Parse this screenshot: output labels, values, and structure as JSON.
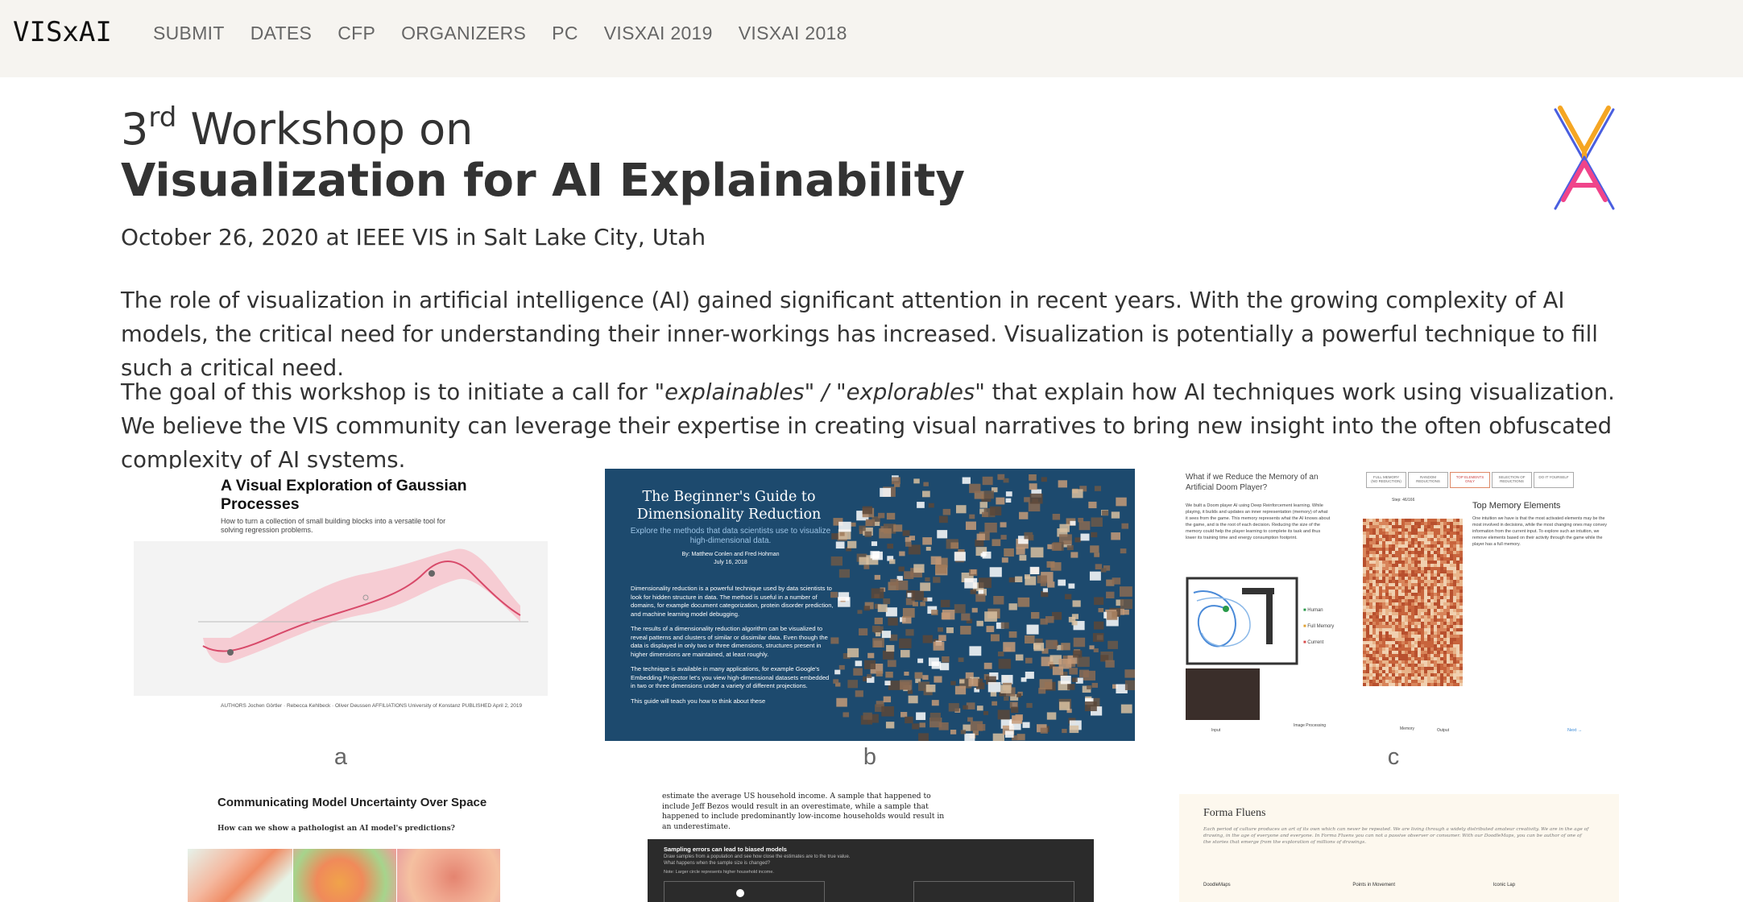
{
  "nav": {
    "brand": "VISxAI",
    "links": [
      "SUBMIT",
      "DATES",
      "CFP",
      "ORGANIZERS",
      "PC",
      "VISXAI 2019",
      "VISXAI 2018"
    ]
  },
  "header": {
    "ordinal": "3",
    "ordinal_suffix": "rd",
    "title_line1_rest": " Workshop on",
    "title_line2": "Visualization for AI Explainability",
    "subtitle": "October 26, 2020 at IEEE VIS in Salt Lake City, Utah"
  },
  "paragraphs": {
    "p1": "The role of visualization in artificial intelligence (AI) gained significant attention in recent years. With the growing complexity of AI models, the critical need for understanding their inner-workings has increased. Visualization is potentially a powerful technique to fill such a critical need.",
    "p2_before": "The goal of this workshop is to initiate a call for ",
    "p2_em": "\"explainables\" / \"explorables\"",
    "p2_after": " that explain how AI techniques work using visualization. We believe the VIS community can leverage their expertise in creating visual narratives to bring new insight into the often obfuscated complexity of AI systems."
  },
  "logo": {
    "letters": [
      "V",
      "A"
    ],
    "colors": {
      "orange": "#f5a623",
      "pink": "#f0448a",
      "blue": "#4a5fe0"
    }
  },
  "gallery": {
    "captions": [
      "a",
      "b",
      "c"
    ],
    "a": {
      "title": "A Visual Exploration of Gaussian Processes",
      "subtitle": "How to turn a collection of small building blocks into a versatile tool for solving regression problems.",
      "meta": "AUTHORS  Jochen Görtler · Rebecca Kehlbeck · Oliver Deussen    AFFILIATIONS  University of Konstanz    PUBLISHED  April 2, 2019"
    },
    "b": {
      "title": "The Beginner's Guide to Dimensionality Reduction",
      "subtitle": "Explore the methods that data scientists use to visualize high-dimensional data.",
      "byline": "By: Matthew Conlen and Fred Hohman",
      "date": "July 16, 2018",
      "body1": "Dimensionality reduction is a powerful technique used by data scientists to look for hidden structure in data. The method is useful in a number of domains, for example document categorization, protein disorder prediction, and machine learning model debugging.",
      "body2": "The results of a dimensionality reduction algorithm can be visualized to reveal patterns and clusters of similar or dissimilar data. Even though the data is displayed in only two or three dimensions, structures present in higher dimensions are maintained, at least roughly.",
      "body3": "The technique is available in many applications, for example Google's Embedding Projector let's you view high-dimensional datasets embedded in two or three dimensions under a variety of different projections.",
      "body4": "This guide will teach you how to think about these"
    },
    "c": {
      "question": "What if we Reduce the Memory of an Artificial Doom Player?",
      "desc": "We built a Doom player AI using Deep Reinforcement learning. While playing, it builds and updates an inner representation (memory) of what it sees from the game. This memory represents what the AI knows about the game, and is the root of each decision. Reducing the size of the memory could help the player learning to complete its task and thus lower its training time and energy consumption footprint.",
      "tabs": [
        "FULL MEMORY (NO REDUCTION)",
        "RANDOM REDUCTIONS",
        "TOP ELEMENTS ONLY",
        "SELECTION OF REDUCTIONS",
        "DO IT YOURSELF"
      ],
      "step": "Step: 46/166",
      "legend": [
        "Human",
        "Full Memory",
        "Current"
      ],
      "panel_title": "Top Memory Elements",
      "panel_text": "One intuition we have is that the most activated elements may be the most involved in decisions, while the most changing ones may convey information from the current input. To explore such an intuition, we remove elements based on their activity through the game while the player has a full memory.",
      "labels": [
        "Input",
        "Image Processing",
        "Memory",
        "Output"
      ],
      "next": "Next →"
    },
    "d": {
      "title": "Communicating Model Uncertainty Over Space",
      "subtitle": "How can we show a pathologist an AI model's predictions?"
    },
    "e": {
      "text": "estimate the average US household income. A sample that happened to include Jeff Bezos would result in an overestimate, while a sample that happened to include predominantly low-income households would result in an underestimate.",
      "dark_title": "Sampling errors can lead to biased models",
      "dark_text": "Draw samples from a population and see how close the estimates are to the true value. What happens when the sample size is changed?",
      "dark_note": "Note: Larger circle represents higher household income."
    },
    "f": {
      "title": "Forma Fluens",
      "text": "Each period of culture produces an art of its own which can never be repeated. We are living through a widely distributed amateur creativity. We are in the age of drawing, in the age of everyone and everyone. In Forma Fluens you can not a passive observer or consumer. With our DoodleMaps, you can be author of one of the stories that emerge from the exploration of millions of drawings.",
      "labels": [
        "DoodleMaps",
        "Points in Movement",
        "Iconic Lap"
      ]
    }
  }
}
